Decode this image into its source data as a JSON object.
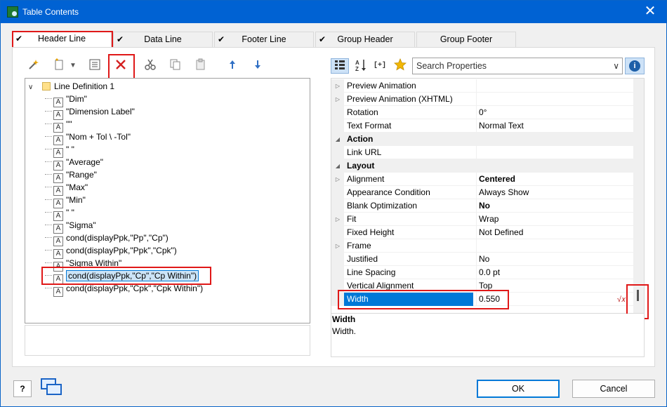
{
  "window": {
    "title": "Table Contents",
    "close_glyph": "✕"
  },
  "tabs": [
    {
      "label": "Header Line",
      "checked": true
    },
    {
      "label": "Data Line",
      "checked": true
    },
    {
      "label": "Footer Line",
      "checked": true
    },
    {
      "label": "Group Header",
      "checked": true
    },
    {
      "label": "Group Footer",
      "checked": false
    }
  ],
  "check_glyph": "✔",
  "toolbar_left": {
    "icons": [
      "wand-icon",
      "new-item-icon",
      "dropdown-arrow-icon",
      "properties-icon",
      "delete-icon",
      "cut-icon",
      "copy-icon",
      "paste-icon",
      "move-up-icon",
      "move-down-icon"
    ]
  },
  "tree": {
    "root_label": "Line Definition  1",
    "items": [
      "\"Dim\"",
      "\"Dimension Label\"",
      "\"\"",
      "\"Nom   + Tol \\ -Tol\"",
      "\" \"",
      "\"Average\"",
      "\"Range\"",
      "\"Max\"",
      "\"Min\"",
      "\" \"",
      "\"Sigma\"",
      "cond(displayPpk,\"Pp\",\"Cp\")",
      "cond(displayPpk,\"Ppk\",\"Cpk\")",
      "\"Sigma Within\"",
      "cond(displayPpk,\"Cp\",\"Cp Within\")",
      "cond(displayPpk,\"Cpk\",\"Cpk Within\")"
    ],
    "selected_index": 14
  },
  "search": {
    "placeholder": "Search Properties"
  },
  "properties": [
    {
      "name": "Preview Animation",
      "value": "",
      "type": "expandable"
    },
    {
      "name": "Preview Animation (XHTML)",
      "value": "",
      "type": "expandable"
    },
    {
      "name": "Rotation",
      "value": "0°",
      "type": "plain"
    },
    {
      "name": "Text Format",
      "value": "Normal Text",
      "type": "plain"
    },
    {
      "name": "Action",
      "value": "",
      "type": "category"
    },
    {
      "name": "Link URL",
      "value": "",
      "type": "plain"
    },
    {
      "name": "Layout",
      "value": "",
      "type": "category"
    },
    {
      "name": "Alignment",
      "value": "Centered",
      "type": "expandable",
      "bold": true
    },
    {
      "name": "Appearance Condition",
      "value": "Always Show",
      "type": "plain"
    },
    {
      "name": "Blank Optimization",
      "value": "No",
      "type": "plain",
      "bold": true
    },
    {
      "name": "Fit",
      "value": "Wrap",
      "type": "expandable"
    },
    {
      "name": "Fixed Height",
      "value": "Not Defined",
      "type": "plain"
    },
    {
      "name": "Frame",
      "value": "",
      "type": "expandable"
    },
    {
      "name": "Justified",
      "value": "No",
      "type": "plain"
    },
    {
      "name": "Line Spacing",
      "value": "0.0 pt",
      "type": "plain"
    },
    {
      "name": "Vertical Alignment",
      "value": "Top",
      "type": "plain"
    },
    {
      "name": "Width",
      "value": "0.550",
      "type": "selected"
    }
  ],
  "description": {
    "title": "Width",
    "text": "Width."
  },
  "buttons": {
    "help": "?",
    "ok": "OK",
    "cancel": "Cancel"
  }
}
